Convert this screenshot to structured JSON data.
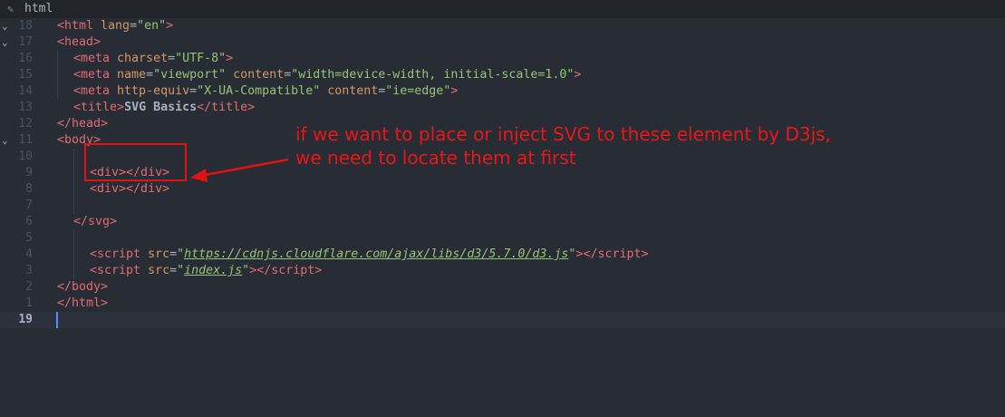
{
  "tab": {
    "icon": "code-file-icon",
    "title": "html"
  },
  "lines": [
    {
      "num": "18",
      "fold": "⌄",
      "indent": 0,
      "tokens": [
        [
          "tag",
          "<html"
        ],
        [
          "attr",
          " lang"
        ],
        [
          "plain",
          "="
        ],
        [
          "str",
          "\"en\""
        ],
        [
          "tag",
          ">"
        ]
      ]
    },
    {
      "num": "17",
      "fold": "⌄",
      "indent": 0,
      "tokens": [
        [
          "tag",
          "<head"
        ],
        [
          "tag",
          ">"
        ]
      ]
    },
    {
      "num": "16",
      "fold": "",
      "indent": 1,
      "tokens": [
        [
          "tag",
          "<meta"
        ],
        [
          "attr",
          " charset"
        ],
        [
          "plain",
          "="
        ],
        [
          "str",
          "\"UTF-8\""
        ],
        [
          "tag",
          ">"
        ]
      ]
    },
    {
      "num": "15",
      "fold": "",
      "indent": 1,
      "tokens": [
        [
          "tag",
          "<meta"
        ],
        [
          "attr",
          " name"
        ],
        [
          "plain",
          "="
        ],
        [
          "str",
          "\"viewport\""
        ],
        [
          "attr",
          " content"
        ],
        [
          "plain",
          "="
        ],
        [
          "str",
          "\"width=device-width, initial-scale=1.0\""
        ],
        [
          "tag",
          ">"
        ]
      ]
    },
    {
      "num": "14",
      "fold": "",
      "indent": 1,
      "tokens": [
        [
          "tag",
          "<meta"
        ],
        [
          "attr",
          " http-equiv"
        ],
        [
          "plain",
          "="
        ],
        [
          "str",
          "\"X-UA-Compatible\""
        ],
        [
          "attr",
          " content"
        ],
        [
          "plain",
          "="
        ],
        [
          "str",
          "\"ie=edge\""
        ],
        [
          "tag",
          ">"
        ]
      ]
    },
    {
      "num": "13",
      "fold": "",
      "indent": 1,
      "tokens": [
        [
          "tag",
          "<title"
        ],
        [
          "tag",
          ">"
        ],
        [
          "bold",
          "SVG Basics"
        ],
        [
          "tag",
          "</title"
        ],
        [
          "tag",
          ">"
        ]
      ]
    },
    {
      "num": "12",
      "fold": "",
      "indent": 0,
      "tokens": [
        [
          "tag",
          "</head"
        ],
        [
          "tag",
          ">"
        ]
      ]
    },
    {
      "num": "11",
      "fold": "⌄",
      "indent": 0,
      "tokens": [
        [
          "tag",
          "<body"
        ],
        [
          "tag",
          ">"
        ]
      ]
    },
    {
      "num": "10",
      "fold": "",
      "indent": 0,
      "tokens": []
    },
    {
      "num": "9",
      "fold": "",
      "indent": 2,
      "tokens": [
        [
          "tag",
          "<div"
        ],
        [
          "tag",
          ">"
        ],
        [
          "tag",
          "</div"
        ],
        [
          "tag",
          ">"
        ]
      ]
    },
    {
      "num": "8",
      "fold": "",
      "indent": 2,
      "tokens": [
        [
          "tag",
          "<div"
        ],
        [
          "tag",
          ">"
        ],
        [
          "tag",
          "</div"
        ],
        [
          "tag",
          ">"
        ]
      ]
    },
    {
      "num": "7",
      "fold": "",
      "indent": 0,
      "tokens": []
    },
    {
      "num": "6",
      "fold": "",
      "indent": 1,
      "tokens": [
        [
          "tag",
          "</svg"
        ],
        [
          "tag",
          ">"
        ]
      ]
    },
    {
      "num": "5",
      "fold": "",
      "indent": 0,
      "tokens": []
    },
    {
      "num": "4",
      "fold": "",
      "indent": 2,
      "tokens": [
        [
          "tag",
          "<script"
        ],
        [
          "attr",
          " src"
        ],
        [
          "plain",
          "="
        ],
        [
          "str",
          "\""
        ],
        [
          "link",
          "https://cdnjs.cloudflare.com/ajax/libs/d3/5.7.0/d3.js"
        ],
        [
          "str",
          "\""
        ],
        [
          "tag",
          ">"
        ],
        [
          "tag",
          "</script"
        ],
        [
          "tag",
          ">"
        ]
      ]
    },
    {
      "num": "3",
      "fold": "",
      "indent": 2,
      "tokens": [
        [
          "tag",
          "<script"
        ],
        [
          "attr",
          " src"
        ],
        [
          "plain",
          "="
        ],
        [
          "str",
          "\""
        ],
        [
          "link",
          "index.js"
        ],
        [
          "str",
          "\""
        ],
        [
          "tag",
          ">"
        ],
        [
          "tag",
          "</script"
        ],
        [
          "tag",
          ">"
        ]
      ]
    },
    {
      "num": "2",
      "fold": "",
      "indent": 0,
      "tokens": [
        [
          "tag",
          "</body"
        ],
        [
          "tag",
          ">"
        ]
      ]
    },
    {
      "num": "1",
      "fold": "",
      "indent": 0,
      "tokens": [
        [
          "tag",
          "</html"
        ],
        [
          "tag",
          ">"
        ]
      ]
    },
    {
      "num": "19",
      "fold": "",
      "indent": 0,
      "tokens": [],
      "current": true
    }
  ],
  "annotation": {
    "line1": "if we want to place or inject SVG to these element by D3js,",
    "line2": "we need to locate them at first",
    "color": "#e81818"
  },
  "colors": {
    "background": "#282c34",
    "tag": "#e06c75",
    "attribute": "#d19a66",
    "string": "#98c379",
    "text": "#abb2bf",
    "annotation": "#e81818"
  }
}
